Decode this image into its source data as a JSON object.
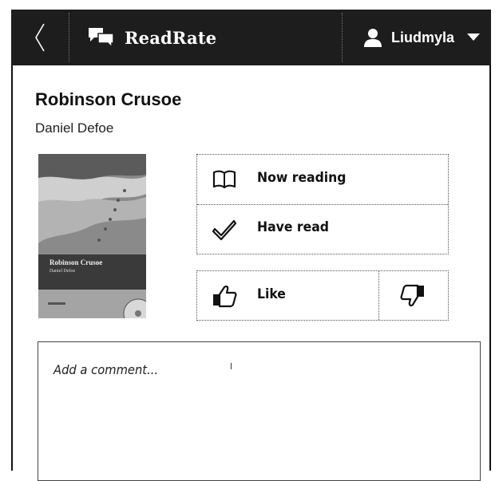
{
  "header": {
    "app_name": "ReadRate",
    "user_name": "Liudmyla"
  },
  "book": {
    "title": "Robinson Crusoe",
    "author": "Daniel Defoe",
    "cover": {
      "title": "Robinson Crusoe",
      "author": "Daniel Defoe"
    }
  },
  "actions": {
    "now_reading": "Now reading",
    "have_read": "Have read",
    "like": "Like"
  },
  "comment": {
    "placeholder": "Add a comment..."
  }
}
